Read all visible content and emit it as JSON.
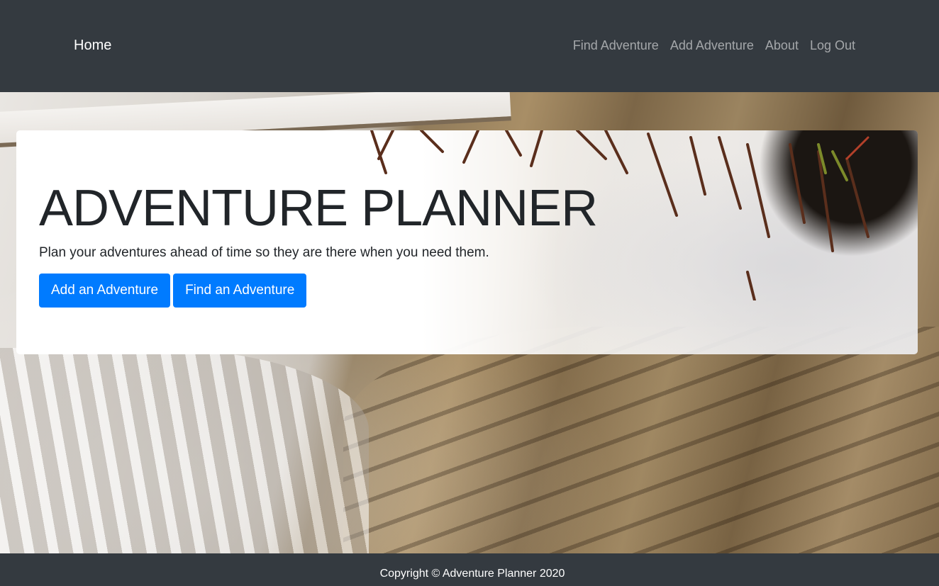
{
  "navbar": {
    "brand": "Home",
    "links": [
      {
        "label": "Find Adventure"
      },
      {
        "label": "Add Adventure"
      },
      {
        "label": "About"
      },
      {
        "label": "Log Out"
      }
    ]
  },
  "hero": {
    "title": "ADVENTURE PLANNER",
    "lead": "Plan your adventures ahead of time so they are there when you need them.",
    "buttons": [
      {
        "label": "Add an Adventure"
      },
      {
        "label": "Find an Adventure"
      }
    ]
  },
  "footer": {
    "text": "Copyright © Adventure Planner 2020"
  },
  "colors": {
    "navbar_bg": "#343a40",
    "primary": "#007bff",
    "nav_link": "rgba(255,255,255,0.55)",
    "text": "#212529"
  },
  "images": {
    "background": "rock-and-snow-photo",
    "jumbotron_background": "snow-with-grass-photo"
  }
}
